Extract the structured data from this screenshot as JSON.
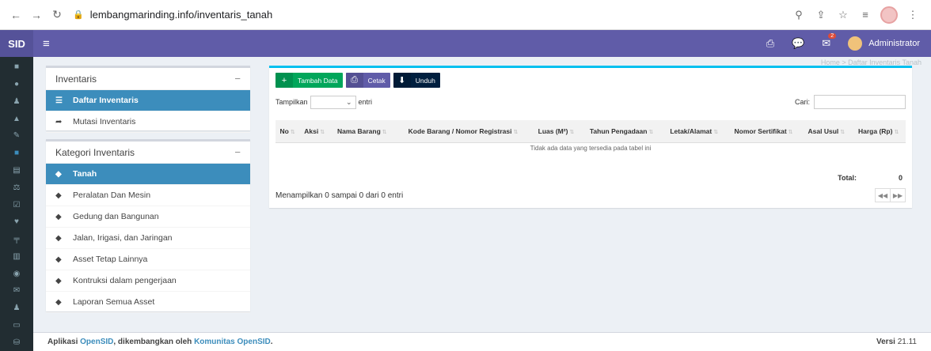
{
  "browser": {
    "url": "lembangmarinding.info/inventaris_tanah"
  },
  "topbar": {
    "logo": "SID",
    "user": "Administrator",
    "notif_count": "2"
  },
  "breadcrumb": "Home > Daftar Inventaris Tanah",
  "inventaris_box": {
    "title": "Inventaris",
    "items": [
      {
        "label": "Daftar Inventaris",
        "icon": "list-icon"
      },
      {
        "label": "Mutasi Inventaris",
        "icon": "share-icon"
      }
    ]
  },
  "kategori_box": {
    "title": "Kategori Inventaris",
    "items": [
      {
        "label": "Tanah",
        "icon": "tag-icon"
      },
      {
        "label": "Peralatan Dan Mesin",
        "icon": "tag-icon"
      },
      {
        "label": "Gedung dan Bangunan",
        "icon": "tag-icon"
      },
      {
        "label": "Jalan, Irigasi, dan Jaringan",
        "icon": "tag-icon"
      },
      {
        "label": "Asset Tetap Lainnya",
        "icon": "tag-icon"
      },
      {
        "label": "Kontruksi dalam pengerjaan",
        "icon": "tag-icon"
      },
      {
        "label": "Laporan Semua Asset",
        "icon": "tag-icon"
      }
    ]
  },
  "toolbar": {
    "add_label": "Tambah Data",
    "print_label": "Cetak",
    "download_label": "Unduh"
  },
  "table": {
    "show_label": "Tampilkan",
    "entries_label": "entri",
    "search_label": "Cari:",
    "columns": [
      "No",
      "Aksi",
      "Nama Barang",
      "Kode Barang / Nomor Registrasi",
      "Luas (M²)",
      "Tahun Pengadaan",
      "Letak/Alamat",
      "Nomor Sertifikat",
      "Asal Usul",
      "Harga (Rp)"
    ],
    "empty_message": "Tidak ada data yang tersedia pada tabel ini",
    "total_label": "Total:",
    "total_value": "0",
    "info": "Menampilkan 0 sampai 0 dari 0 entri"
  },
  "footer": {
    "prefix": "Aplikasi",
    "app_name": "OpenSID",
    "middle": ", dikembangkan oleh",
    "community": "Komunitas OpenSID",
    "end": ".",
    "version_label": "Versi",
    "version": "21.11"
  },
  "colors": {
    "navbar": "#605ca8",
    "sidebar": "#222d32",
    "active_item": "#3c8dbc",
    "add_button": "#00a65a",
    "download_button": "#001f3f"
  }
}
